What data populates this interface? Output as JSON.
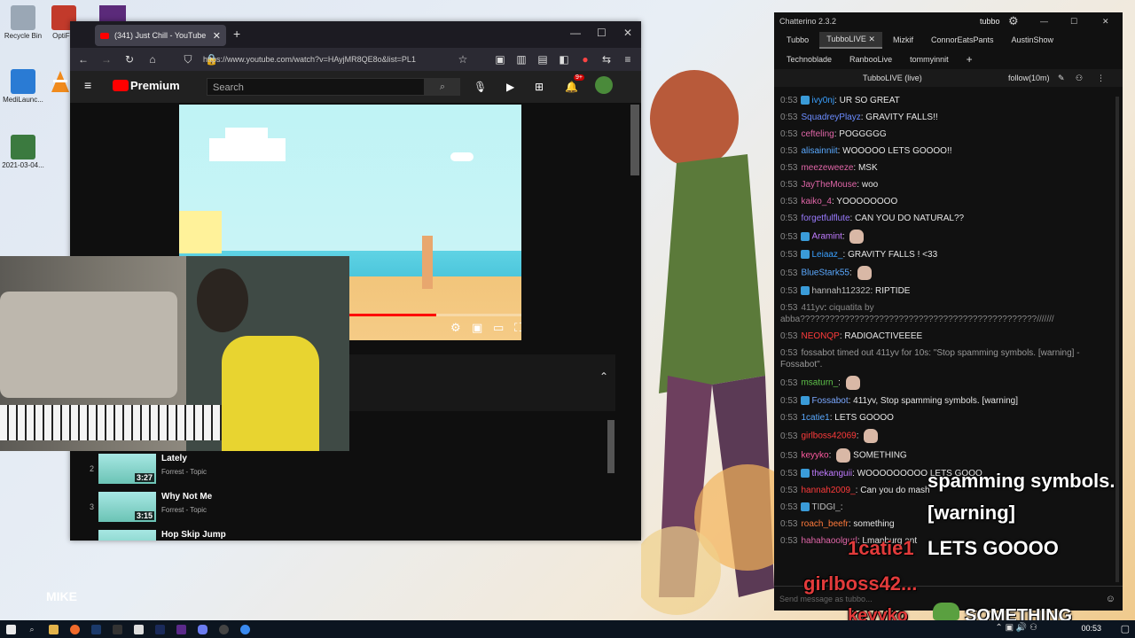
{
  "desktop": {
    "icons": [
      {
        "label": "Recycle Bin",
        "color": "#9aa7b5"
      },
      {
        "label": "OptiFin",
        "color": "#c23a2b"
      },
      {
        "label": "MediLaunc...",
        "color": "#2a7bd4"
      },
      {
        "label": "2021-03-04...",
        "color": "#3b7a3f"
      }
    ],
    "mike_label": "MIKE"
  },
  "browser": {
    "tab_title": "(341) Just Chill - YouTube",
    "new_tab_icon": "+",
    "url": "https://www.youtube.com/watch?v=HAyjMR8QE8o&list=PL1",
    "youtube": {
      "logo_text": "Premium",
      "search_placeholder": "Search",
      "notification_count": "9+"
    },
    "playlist": [
      {
        "index": "2",
        "title": "Lately",
        "channel": "Forrest - Topic",
        "duration": "3:27"
      },
      {
        "index": "3",
        "title": "Why Not Me",
        "channel": "Forrest - Topic",
        "duration": "3:15"
      },
      {
        "index": "",
        "title": "Hop Skip Jump",
        "channel": "",
        "duration": ""
      }
    ],
    "progress_fraction": 0.75
  },
  "chatterino": {
    "app_title": "Chatterino 2.3.2",
    "user": "tubbo",
    "tabs_row1": [
      "Tubbo",
      "TubboLIVE",
      "Mizkif",
      "ConnorEatsPants",
      "AustinShow"
    ],
    "tabs_row2": [
      "Technoblade",
      "RanbooLive",
      "tommyinnit"
    ],
    "active_tab": "TubboLIVE",
    "channel_label": "TubboLIVE (live)",
    "follow_label": "follow(10m)",
    "messages": [
      {
        "ts": "0:53",
        "user": "ivy0nj",
        "color": "#3aa0ff",
        "text": "UR SO GREAT",
        "badge": true
      },
      {
        "ts": "0:53",
        "user": "SquadreyPlayz",
        "color": "#6b8cff",
        "text": "GRAVITY FALLS!!",
        "badge": false
      },
      {
        "ts": "0:53",
        "user": "cefteling",
        "color": "#e066a8",
        "text": "POGGGGG",
        "badge": false
      },
      {
        "ts": "0:53",
        "user": "alisainniit",
        "color": "#5aa9ff",
        "text": "WOOOOO LETS GOOOO!!",
        "badge": false
      },
      {
        "ts": "0:53",
        "user": "meezeweeze",
        "color": "#e066a8",
        "text": "MSK",
        "badge": false
      },
      {
        "ts": "0:53",
        "user": "JayTheMouse",
        "color": "#e066a8",
        "text": "woo",
        "badge": false
      },
      {
        "ts": "0:53",
        "user": "kaiko_4",
        "color": "#e066a8",
        "text": "YOOOOOOOO",
        "badge": false
      },
      {
        "ts": "0:53",
        "user": "forgetfulflute",
        "color": "#9b7bff",
        "text": "CAN YOU DO NATURAL??",
        "badge": false
      },
      {
        "ts": "0:53",
        "user": "Aramint",
        "color": "#c07bff",
        "text": "",
        "badge": true,
        "emote": true
      },
      {
        "ts": "0:53",
        "user": "Leiaaz_",
        "color": "#3aa0ff",
        "text": "GRAVITY FALLS ! <33",
        "badge": true
      },
      {
        "ts": "0:53",
        "user": "BlueStark55",
        "color": "#5aa9ff",
        "text": "",
        "badge": false,
        "emote": true
      },
      {
        "ts": "0:53",
        "user": "hannah112322",
        "color": "#bdbdbd",
        "text": "RIPTIDE",
        "badge": true
      },
      {
        "ts": "0:53",
        "user": "411yv",
        "color": "#888888",
        "text": "ciquatita by abba????????????????????????????????????????????????///////",
        "badge": false,
        "dim": true
      },
      {
        "ts": "0:53",
        "user": "NEONQP",
        "color": "#ff3b3b",
        "text": "RADIOACTIVEEEE",
        "badge": false
      },
      {
        "ts": "0:53",
        "user": "",
        "color": "#999999",
        "text": "fossabot timed out 411yv for 10s: \"Stop spamming symbols. [warning] - Fossabot\".",
        "badge": false,
        "system": true
      },
      {
        "ts": "0:53",
        "user": "msaturn_",
        "color": "#5ec24a",
        "text": "",
        "badge": false,
        "emote": true
      },
      {
        "ts": "0:53",
        "user": "Fossabot",
        "color": "#7aa8ff",
        "text": "411yv, Stop spamming symbols. [warning]",
        "badge": true
      },
      {
        "ts": "0:53",
        "user": "1catie1",
        "color": "#5aa9ff",
        "text": "LETS GOOOO",
        "badge": false
      },
      {
        "ts": "0:53",
        "user": "girlboss42069",
        "color": "#ff3b3b",
        "text": "",
        "badge": false,
        "emote": true
      },
      {
        "ts": "0:53",
        "user": "keyyko",
        "color": "#ff5aa0",
        "text": "SOMETHING",
        "badge": false,
        "emote": true
      },
      {
        "ts": "0:53",
        "user": "thekanguii",
        "color": "#c07bff",
        "text": "WOOOOOOOOO LETS GOOO",
        "badge": true
      },
      {
        "ts": "0:53",
        "user": "hannah2009_",
        "color": "#ff3b3b",
        "text": "Can you do mash",
        "badge": false
      },
      {
        "ts": "0:53",
        "user": "TIDGI_",
        "color": "#bdbdbd",
        "text": "",
        "badge": true
      },
      {
        "ts": "0:53",
        "user": "roach_beefr",
        "color": "#ff7a3b",
        "text": "something",
        "badge": false
      },
      {
        "ts": "0:53",
        "user": "hahahaoolgurl",
        "color": "#e066a8",
        "text": "Lmanburg ant",
        "badge": false
      }
    ],
    "input_placeholder": "Send message as tubbo..."
  },
  "overlay": {
    "line1": "spamming symbols.",
    "line2": "[warning]",
    "name1": "1catie1",
    "text1": "LETS GOOOO",
    "name2": "girlboss42...",
    "name3": "keyyko",
    "text3": "SOMETHING"
  },
  "taskbar": {
    "time": "00:53"
  }
}
